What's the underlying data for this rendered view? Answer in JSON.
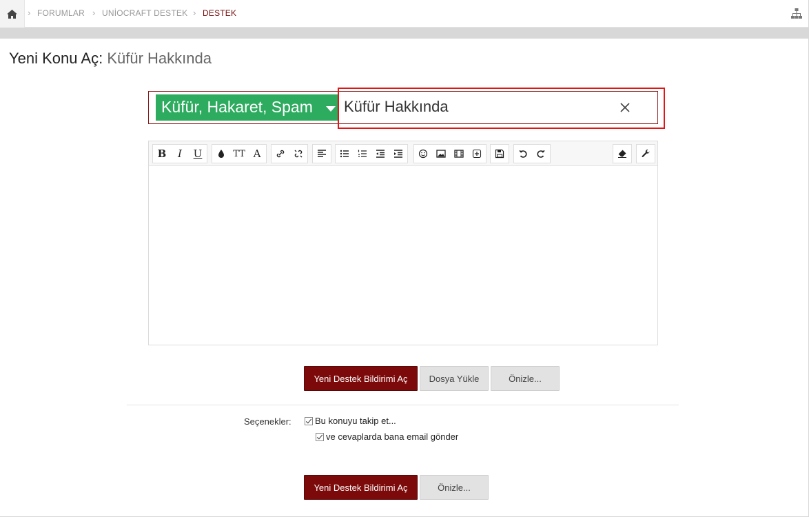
{
  "breadcrumb": {
    "items": [
      "FORUMLAR",
      "UNİOCRAFT DESTEK",
      "DESTEK"
    ]
  },
  "page": {
    "title_prefix": "Yeni Konu Aç:",
    "title_thread": "Küfür Hakkında"
  },
  "form": {
    "prefix_label": "Küfür, Hakaret, Spam",
    "title_value": "Küfür Hakkında"
  },
  "toolbar": {
    "bold": "B",
    "italic": "I",
    "underline": "U",
    "size": "TT",
    "font": "A"
  },
  "buttons": {
    "submit_label": "Yeni Destek Bildirimi Aç",
    "upload_label": "Dosya Yükle",
    "preview_label": "Önizle..."
  },
  "options": {
    "label": "Seçenekler:",
    "watch_label": "Bu konuyu takip et...",
    "email_label": "ve cevaplarda bana email gönder",
    "watch_checked": true,
    "email_checked": true
  },
  "colors": {
    "accent": "#7c0a0a",
    "prefix_green": "#2dab5f",
    "highlight": "#e01515"
  }
}
